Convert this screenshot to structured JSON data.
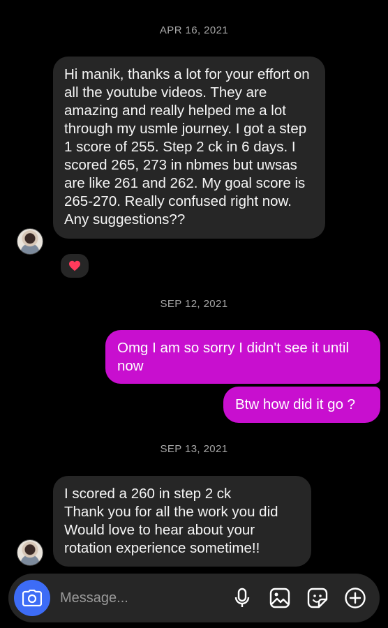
{
  "thread": {
    "dates": [
      "APR 16, 2021",
      "SEP 12, 2021",
      "SEP 13, 2021"
    ],
    "messages": [
      {
        "from": "them",
        "text": "Hi manik, thanks a lot for your effort on all the youtube videos. They are amazing and really helped me a lot through my usmle journey. I got a step 1 score of 255. Step 2 ck in 6 days. I scored 265, 273 in nbmes but uwsas are like 261 and 262. My goal score is 265-270. Really confused right now. Any suggestions??"
      },
      {
        "from": "me",
        "text": "Omg I am so sorry I didn't see it until now"
      },
      {
        "from": "me",
        "text": "Btw how did it go ?"
      },
      {
        "from": "them",
        "lines": [
          "I scored a 260 in step 2 ck",
          "Thank you for all the work you did",
          "Would love to hear about your",
          "rotation experience sometime!!"
        ]
      }
    ],
    "reaction": "heart"
  },
  "composer": {
    "placeholder": "Message...",
    "icons": [
      "camera-icon",
      "microphone-icon",
      "gallery-icon",
      "sticker-icon",
      "plus-icon"
    ]
  },
  "colors": {
    "background": "#000000",
    "incoming_bubble": "#262626",
    "outgoing_bubble": "#c80fcf",
    "camera_button": "#3d6cf6",
    "reaction_heart": "#ff3b5c"
  }
}
